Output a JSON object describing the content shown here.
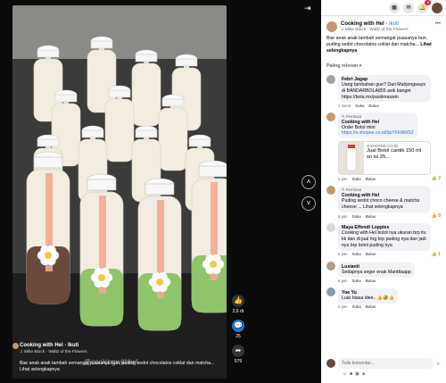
{
  "video": {
    "author": "Cooking with Hel",
    "follow": "Ikuti",
    "music": "Mike Block · Waltz of the Flowers",
    "caption": "Biar anak anak tambah semangat puasanya bun, puding sedot chocolatos coklat dan matcha... Lihat selengkapnya",
    "watermark": "@cookingwithhel",
    "likes": "2,6 rb",
    "comments": "25",
    "shares": "579",
    "prev_icon": "chevron-up-icon",
    "next_icon": "chevron-down-icon",
    "collapse_icon": "collapse-icon"
  },
  "topbar": {
    "badge": "4",
    "icons": [
      "grid-icon",
      "messenger-icon",
      "bell-icon",
      "avatar"
    ]
  },
  "post": {
    "author": "Cooking with Hel",
    "follow": "Ikuti",
    "music": "Mike Block · Waltz of the Flowers",
    "caption": "Biar anak anak tambah semangat puasanya bun, puding sedot chocolatos coklat dan matcha...",
    "see_more": "Lihat selengkapnya"
  },
  "sort": {
    "label": "Paling relevan"
  },
  "comments": [
    {
      "name": "Febri Jagap",
      "text": "Uang tambahan gue? Dari Mahjongways di BANDARBOLA855 asik banget https://bola.mx/pastimaswin",
      "time": "1 menit",
      "like": "Suka",
      "reply": "Balas"
    },
    {
      "tag": "Pembuat",
      "name": "Cooking with Hel",
      "text": "Order Botol mini",
      "link": "https://s.shopee.co.id/9pYFkWhf3Z",
      "ad_site": "S.SHOPEE.CO.ID",
      "ad_title": "Jual Botol cantik 150 ml sn isi 25...",
      "time": "6 jam",
      "like": "Suka",
      "reply": "Balas",
      "reactions": "2"
    },
    {
      "tag": "Pembuat",
      "name": "Cooking with Hel",
      "text": "Puding sedot choco cheese & matcha cheese ... Lihat selengkapnya",
      "time": "6 jam",
      "like": "Suka",
      "reply": "Balas",
      "reactions": "8"
    },
    {
      "name": "Maya Effendi Loppies",
      "text": "Cooking with Hel botol nya ukuran brp itu kk dan di jual hrg brp puding nya dan jadi nya brp botol puding nya",
      "time": "5 jam",
      "like": "Suka",
      "reply": "Balas",
      "reactions": "1"
    },
    {
      "name": "Lusianti",
      "text": "Sedapnya seger enak Mantttaapp",
      "time": "6 jam",
      "like": "Suka",
      "reply": "Balas"
    },
    {
      "name": "Yoe Yu",
      "text": "Luar biasa idee.. 👍🤣👍",
      "time": "6 jam",
      "like": "Suka",
      "reply": "Balas"
    }
  ],
  "composer": {
    "placeholder": "Tulis komentar..."
  },
  "colors": {
    "accent": "#1b74e4",
    "matcha": "#8fc46a",
    "choco": "#6b4a3e",
    "cream": "#f2ede0"
  }
}
